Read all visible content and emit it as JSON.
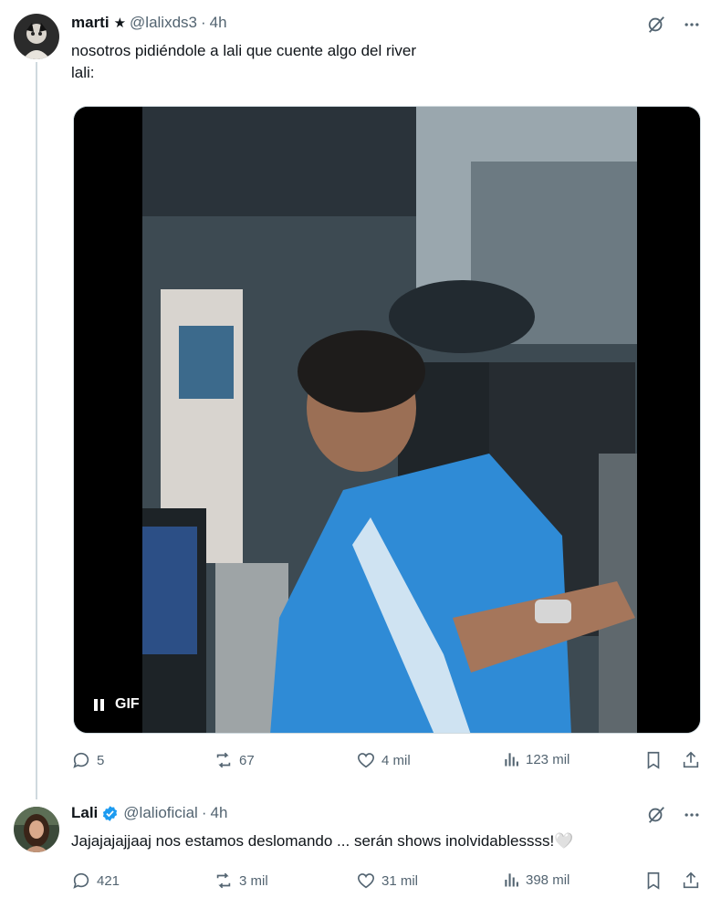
{
  "tweets": [
    {
      "name": "marti",
      "star": "★",
      "handle": "@lalixds3",
      "time": "4h",
      "text_lines": [
        "nosotros pidiéndole a lali que cuente algo del river",
        "lali:"
      ],
      "media_label": "GIF",
      "stats": {
        "replies": "5",
        "retweets": "67",
        "likes": "4 mil",
        "views": "123 mil"
      }
    },
    {
      "name": "Lali",
      "handle": "@lalioficial",
      "time": "4h",
      "text": "Jajajajajjaaj nos estamos deslomando ... serán shows inolvidablessss!🤍",
      "stats": {
        "replies": "421",
        "retweets": "3 mil",
        "likes": "31 mil",
        "views": "398 mil"
      }
    }
  ],
  "separator": "·",
  "colors": {
    "text": "#0f1419",
    "secondary": "#536471",
    "verified": "#1d9bf0",
    "line": "#cfd9de"
  },
  "icons": [
    "grok-icon",
    "more-icon",
    "reply-icon",
    "retweet-icon",
    "like-icon",
    "views-icon",
    "bookmark-icon",
    "share-icon",
    "verified-badge-icon",
    "pause-icon"
  ]
}
